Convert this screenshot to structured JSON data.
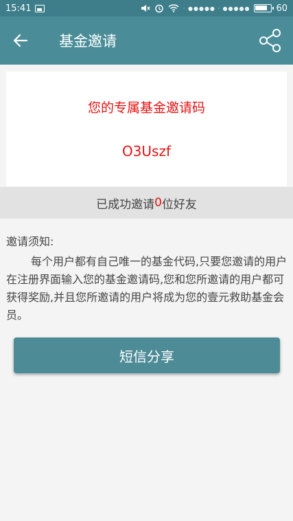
{
  "status": {
    "time": "15:41",
    "battery": "60",
    "signal_dots": "· ●●●●● · ●●●●●"
  },
  "appbar": {
    "title": "基金邀请"
  },
  "invite": {
    "label": "您的专属基金邀请码",
    "code": "O3Uszf"
  },
  "invited": {
    "prefix": "已成功邀请",
    "count": "0",
    "suffix": "位好友"
  },
  "notice": {
    "title": "邀请须知:",
    "body": "每个用户都有自己唯一的基金代码,只要您邀请的用户在注册界面输入您的基金邀请码,您和您所邀请的用户都可获得奖励,并且您所邀请的用户将成为您的壹元救助基金会员。"
  },
  "actions": {
    "sms_share": "短信分享"
  },
  "colors": {
    "appbar": "#4a8d98",
    "statusbar": "#3d7e8a",
    "accent_red": "#e31212",
    "button": "#4d8b97"
  }
}
